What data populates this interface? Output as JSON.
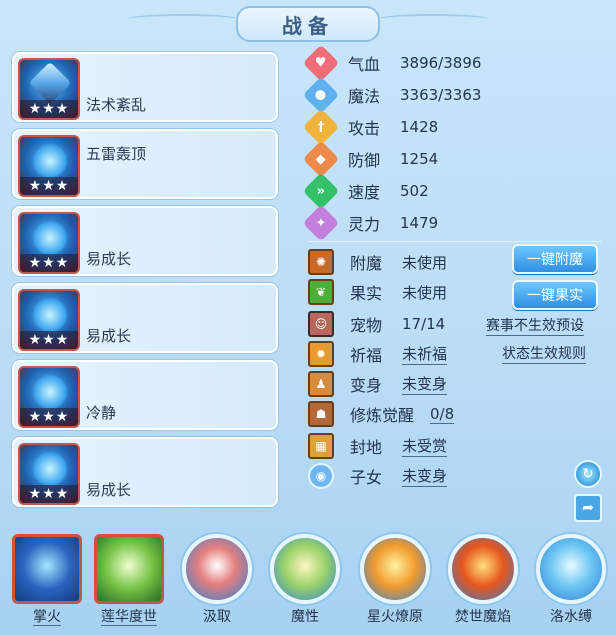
{
  "window": {
    "title": "战备"
  },
  "skill_cards": [
    {
      "label": "法术紊乱",
      "stars": "★★★",
      "icon": "crossed-swords-icon"
    },
    {
      "label": "五雷轰顶",
      "stars": "★★★",
      "icon": "blue-helmet-icon"
    },
    {
      "label": "易成长",
      "stars": "★★★",
      "icon": "blue-armor-icon"
    },
    {
      "label": "易成长",
      "stars": "★★★",
      "icon": "blue-armor-icon"
    },
    {
      "label": "冷静",
      "stars": "★★★",
      "icon": "blue-helmet-icon"
    },
    {
      "label": "易成长",
      "stars": "★★★",
      "icon": "blue-armor-icon"
    }
  ],
  "stats": [
    {
      "name": "气血",
      "value": "3896/3896",
      "color": "#ef6d78",
      "icon": "heart-icon"
    },
    {
      "name": "魔法",
      "value": "3363/3363",
      "color": "#5fb2ef",
      "icon": "mana-drop-icon"
    },
    {
      "name": "攻击",
      "value": "1428",
      "color": "#f2b33c",
      "icon": "sword-icon"
    },
    {
      "name": "防御",
      "value": "1254",
      "color": "#f08a4a",
      "icon": "shield-icon"
    },
    {
      "name": "速度",
      "value": "502",
      "color": "#35c06a",
      "icon": "speed-icon"
    },
    {
      "name": "灵力",
      "value": "1479",
      "color": "#c47fdc",
      "icon": "spirit-icon"
    }
  ],
  "info": [
    {
      "name": "附魔",
      "value": "未使用",
      "underlined": false,
      "icon": "enchant-icon"
    },
    {
      "name": "果实",
      "value": "未使用",
      "underlined": false,
      "icon": "fruit-icon"
    },
    {
      "name": "宠物",
      "value": "17/14",
      "underlined": false,
      "icon": "pet-avatar-icon"
    },
    {
      "name": "祈福",
      "value": "未祈福",
      "underlined": true,
      "icon": "blessing-icon"
    },
    {
      "name": "变身",
      "value": "未变身",
      "underlined": true,
      "icon": "transform-icon"
    },
    {
      "name": "修炼觉醒",
      "value": "0/8",
      "underlined": true,
      "icon": "cultivation-icon"
    },
    {
      "name": "封地",
      "value": "未受赏",
      "underlined": true,
      "icon": "fief-icon"
    },
    {
      "name": "子女",
      "value": "未变身",
      "underlined": true,
      "icon": "child-icon"
    }
  ],
  "buttons": {
    "enchant": "一键附魔",
    "fruit": "一键果实"
  },
  "links": {
    "event_preset": "赛事不生效预设",
    "status_rules": "状态生效规则"
  },
  "bottom_skills": [
    {
      "label": "掌火",
      "underlined": true
    },
    {
      "label": "莲华度世",
      "underlined": true
    },
    {
      "label": "汲取",
      "underlined": false
    },
    {
      "label": "魔性",
      "underlined": false
    },
    {
      "label": "星火燎原",
      "underlined": false
    },
    {
      "label": "焚世魔焰",
      "underlined": false
    },
    {
      "label": "洛水缚",
      "underlined": false
    }
  ],
  "colors": {
    "accent_button": "#2f8fe3",
    "card_border_red": "#c2574a",
    "panel_bg": "#c9e6fa"
  }
}
